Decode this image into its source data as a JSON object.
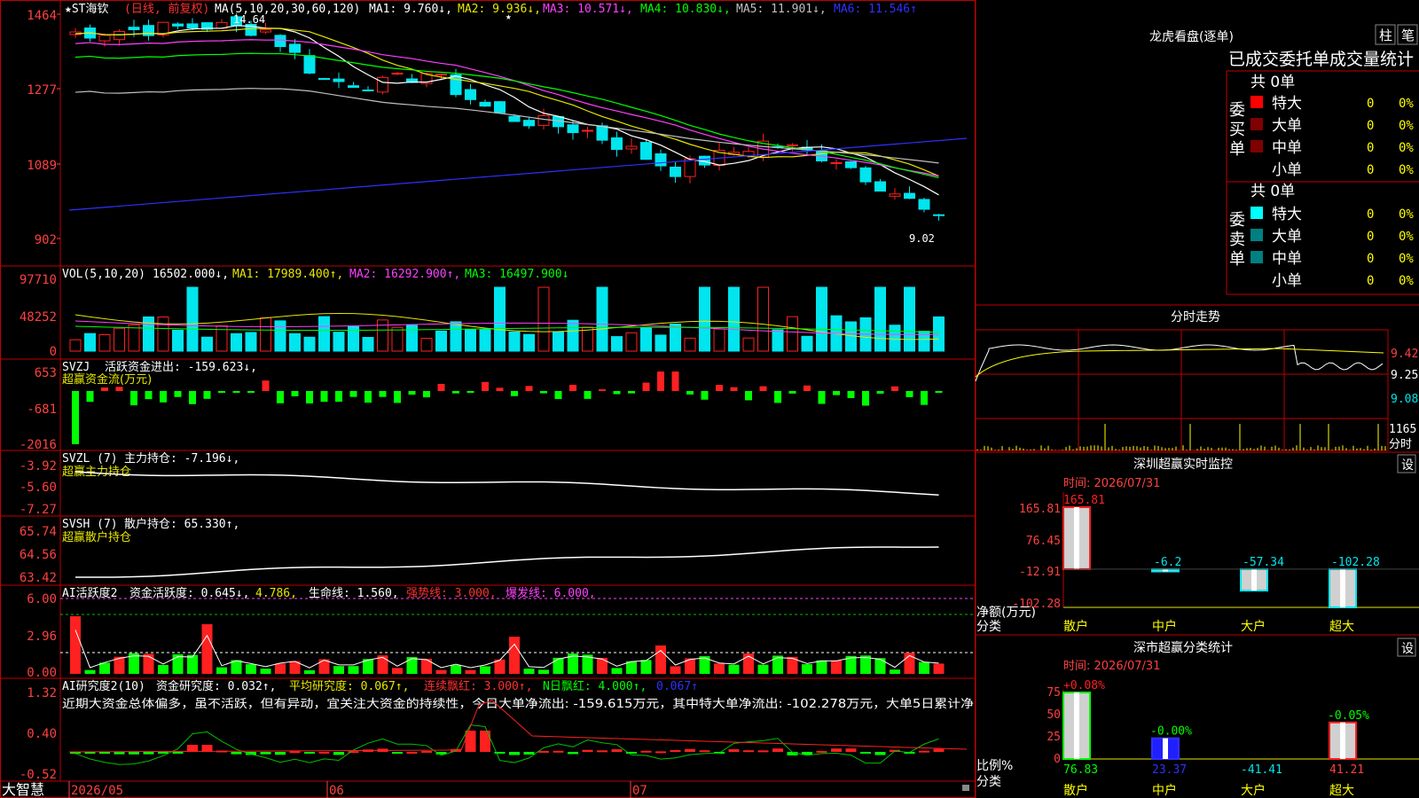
{
  "colors": {
    "up": "#ff2020",
    "down": "#00e5ee",
    "frame": "#c00000",
    "axis_red": "#ff4040",
    "ma5": "#ffffff",
    "ma10": "#e6e600",
    "ma20": "#ff40ff",
    "ma30": "#00ff00",
    "ma60": "#c0c0c0",
    "ma120": "#3030ff",
    "green_bar": "#00ff00",
    "yellow": "#ffff00"
  },
  "price": {
    "stock_name": "★ST海钦",
    "period": "(日线, 前复权)",
    "ma_label": "MA(5,10,20,30,60,120)",
    "ma_values": [
      "MA1: 9.760↓,",
      "MA2: 9.936↓,",
      "MA3: 10.571↓,",
      "MA4: 10.830↓,",
      "MA5: 11.901↓,",
      "MA6: 11.546↑"
    ],
    "y_ticks": [
      "1464",
      "1277",
      "1089",
      "902"
    ],
    "y_range": [
      870,
      1480
    ],
    "high_label": "14.64",
    "low_label": "9.02",
    "star": "★"
  },
  "vol": {
    "label": "VOL(5,10,20)",
    "value": "16502.000↓,",
    "ma_values": [
      "MA1: 17989.400↑,",
      "MA2: 16292.900↑,",
      "MA3: 16497.900↓"
    ],
    "y_ticks": [
      "97710",
      "48252",
      "0"
    ]
  },
  "svzj": {
    "label": "SVZJ",
    "name": "活跃资金进出: -159.623↓,",
    "subtitle": "超赢资金流(万元)",
    "y_ticks": [
      "653",
      "-681",
      "-2016"
    ]
  },
  "svzl": {
    "label": "SVZL (7)",
    "name": "主力持仓: -7.196↓,",
    "subtitle": "超赢主力持仓",
    "y_ticks": [
      "-3.92",
      "-5.60",
      "-7.27"
    ]
  },
  "svsh": {
    "label": "SVSH (7)",
    "name": "散户持仓: 65.330↑,",
    "subtitle": "超赢散户持仓",
    "y_ticks": [
      "65.74",
      "64.56",
      "63.42"
    ]
  },
  "ai1": {
    "label": "AI活跃度2",
    "name": "资金活跃度: 0.645↓,",
    "val2": "4.786,",
    "life": "生命线: 1.560,",
    "strong": "强势线: 3.000,",
    "burst": "爆发线: 6.000,",
    "y_ticks": [
      "6.00",
      "2.96",
      "0.00"
    ]
  },
  "ai2": {
    "label": "AI研究度2(10)",
    "name": "资金研究度: 0.032↑,",
    "avg": "平均研究度: 0.067↑,",
    "cont": "连续飘红: 3.000↑,",
    "nday": "N日飘红: 4.000↑,",
    "last": "0.067↑",
    "comment": "近期大资金总体偏多，虽不活跃，但有异动，宜关注大资金的持续性，今日大单净流出: -159.615万元，其中特大单净流出: -102.278万元，大单5日累计净",
    "y_ticks": [
      "1.32",
      "0.40",
      "-0.52"
    ]
  },
  "x_axis": {
    "app_name": "大智慧",
    "labels": [
      "2026/05",
      "06",
      "07"
    ]
  },
  "lhb": {
    "title": "龙虎看盘(逐单)",
    "btn1": "柱",
    "btn2": "笔",
    "header": "已成交委托单成交量统计",
    "buy_label": "委买单",
    "sell_label": "委卖单",
    "buy_total": "共 0单",
    "sell_total": "共 0单",
    "rows": [
      {
        "name": "特大",
        "count": "0",
        "pct": "0%"
      },
      {
        "name": "大单",
        "count": "0",
        "pct": "0%"
      },
      {
        "name": "中单",
        "count": "0",
        "pct": "0%"
      },
      {
        "name": "小单",
        "count": "0",
        "pct": "0%"
      }
    ]
  },
  "intraday": {
    "title": "分时走势",
    "y_ticks": [
      "9.42",
      "9.25",
      "9.08"
    ],
    "vol_tick": "1165",
    "vol_unit": "分时"
  },
  "sz_monitor": {
    "title": "深圳超赢实时监控",
    "btn": "设",
    "time": "时间: 2026/07/31",
    "y_ticks": [
      "165.81",
      "76.45",
      "-12.91",
      "-102.28"
    ],
    "bar_values": [
      "165.81",
      "-6.2",
      "-57.34",
      "-102.28"
    ],
    "bars": [
      165.81,
      -6.2,
      -57.34,
      -102.28
    ],
    "ylabel": "净额(万元)",
    "xlabel": "分类",
    "categories": [
      "散户",
      "中户",
      "大户",
      "超大"
    ]
  },
  "sz_stats": {
    "title": "深市超赢分类统计",
    "btn": "设",
    "time": "时间: 2026/07/31",
    "y_ticks": [
      "75",
      "50",
      "25",
      "0"
    ],
    "top_labels": [
      "+0.08%",
      "-0.00%",
      "",
      "-0.05%"
    ],
    "bottom_values": [
      "76.83",
      "23.37",
      "-41.41",
      "41.21"
    ],
    "bars": [
      76.83,
      23.37,
      0,
      41.21
    ],
    "ylabel": "比例%",
    "xlabel": "分类",
    "categories": [
      "散户",
      "中户",
      "大户",
      "超大"
    ]
  },
  "chart_data": {
    "type": "bar",
    "title": "",
    "categories": [
      "散户",
      "中户",
      "大户",
      "超大"
    ],
    "series": [
      {
        "name": "净额(万元)",
        "values": [
          165.81,
          -6.2,
          -57.34,
          -102.28
        ]
      },
      {
        "name": "比例%",
        "values": [
          76.83,
          23.37,
          -41.41,
          41.21
        ]
      }
    ],
    "xlabel": "分类",
    "ylabel": "净额(万元)",
    "ylim": [
      -102.28,
      165.81
    ]
  }
}
